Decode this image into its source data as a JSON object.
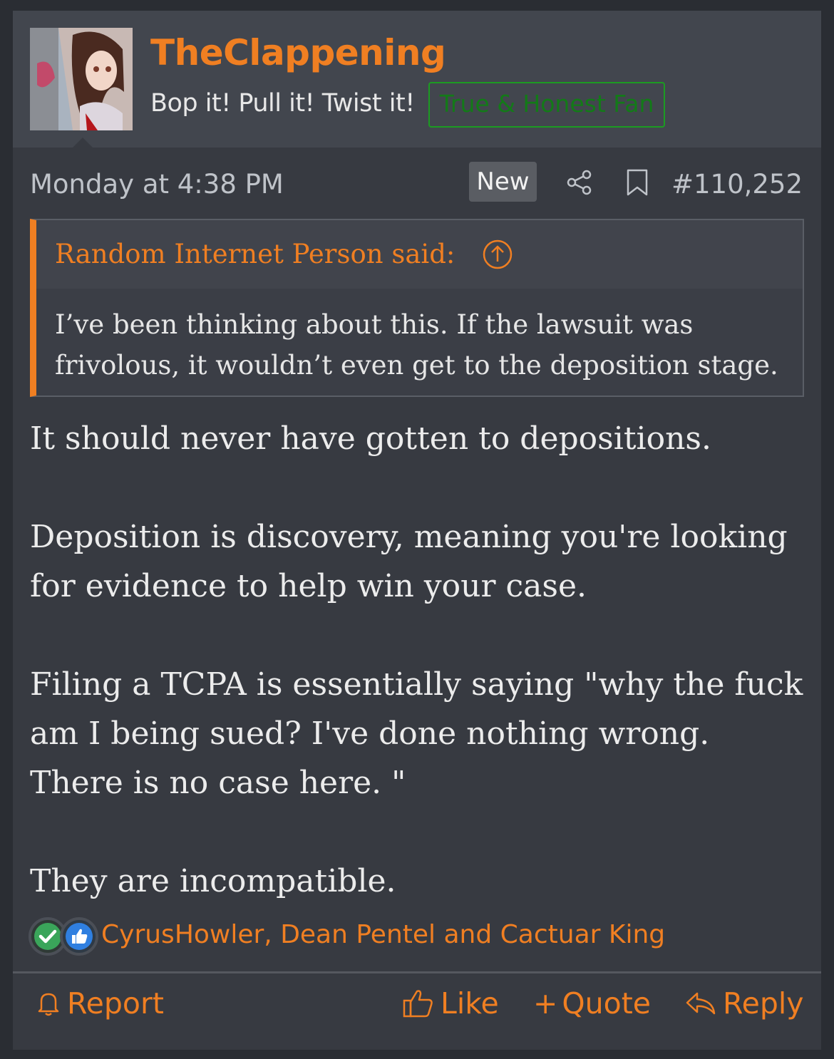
{
  "header": {
    "username": "TheClappening",
    "tagline": "Bop it! Pull it! Twist it!",
    "banner": "True & Honest Fan",
    "avatar_icon": "anime-character-avatar"
  },
  "meta": {
    "date": "Monday at 4:38 PM",
    "new_badge": "New",
    "share_icon": "share-icon",
    "bookmark_icon": "bookmark-icon",
    "post_number": "#110,252"
  },
  "quote": {
    "attribution": "Random Internet Person said:",
    "body": "I’ve been thinking about this. If the lawsuit was frivolous, it wouldn’t even get to the deposition stage."
  },
  "message": {
    "paragraphs": [
      "It should never have gotten to depositions.",
      "Deposition is discovery, meaning you're looking for evidence to help win your case.",
      "Filing a TCPA is essentially saying \"why the fuck am I being sued? I've done nothing wrong. There is no case here. \"",
      "They are incompatible."
    ]
  },
  "reactions": {
    "names": "CyrusHowler, Dean Pentel and Cactuar King",
    "icons": [
      "check-reaction-icon",
      "like-reaction-icon"
    ]
  },
  "actions": {
    "report": "Report",
    "like": "Like",
    "quote": "Quote",
    "reply": "Reply"
  },
  "colors": {
    "accent": "#f07f22",
    "background": "#373a41",
    "header": "#42464e",
    "banner_green": "#1c9b22"
  }
}
